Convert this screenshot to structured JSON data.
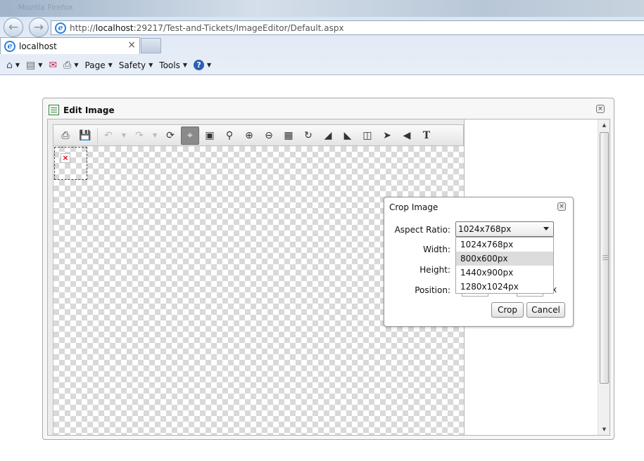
{
  "browser": {
    "window_title": "Mozilla Firefox",
    "url_prefix": "http://",
    "url_host": "localhost",
    "url_rest": ":29217/Test-and-Tickets/ImageEditor/Default.aspx",
    "tab_title": "localhost",
    "tab_close": "×",
    "command_bar": {
      "page": "Page",
      "safety": "Safety",
      "tools": "Tools",
      "help": "?"
    }
  },
  "editor": {
    "title": "Edit Image",
    "close": "×",
    "broken_image_glyph": "×",
    "toolbar_icons": [
      "print-icon",
      "save-icon",
      "undo-icon",
      "undo-dropdown-icon",
      "redo-icon",
      "redo-dropdown-icon",
      "reset-icon",
      "crop-icon",
      "resize-icon",
      "zoom-icon",
      "zoom-in-icon",
      "zoom-out-icon",
      "best-fit-icon",
      "rotate-icon",
      "flip-icon",
      "flip-vertical-icon",
      "flip-horizontal-icon",
      "opacity-icon",
      "mirror-icon",
      "add-text-icon"
    ]
  },
  "crop_dialog": {
    "title": "Crop Image",
    "close": "×",
    "aspect_ratio_label": "Aspect Ratio:",
    "width_label": "Width:",
    "height_label": "Height:",
    "position_label": "Position:",
    "position_unit": "x",
    "aspect_ratio_selected": "1024x768px",
    "aspect_ratio_options": [
      "1024x768px",
      "800x600px",
      "1440x900px",
      "1280x1024px"
    ],
    "highlighted_option": "800x600px",
    "crop_button": "Crop",
    "cancel_button": "Cancel"
  },
  "colors": {
    "ie_blue": "#2f7fd6",
    "doc_icon_green": "#2e7d32",
    "broken_image_red": "#d0021b"
  }
}
